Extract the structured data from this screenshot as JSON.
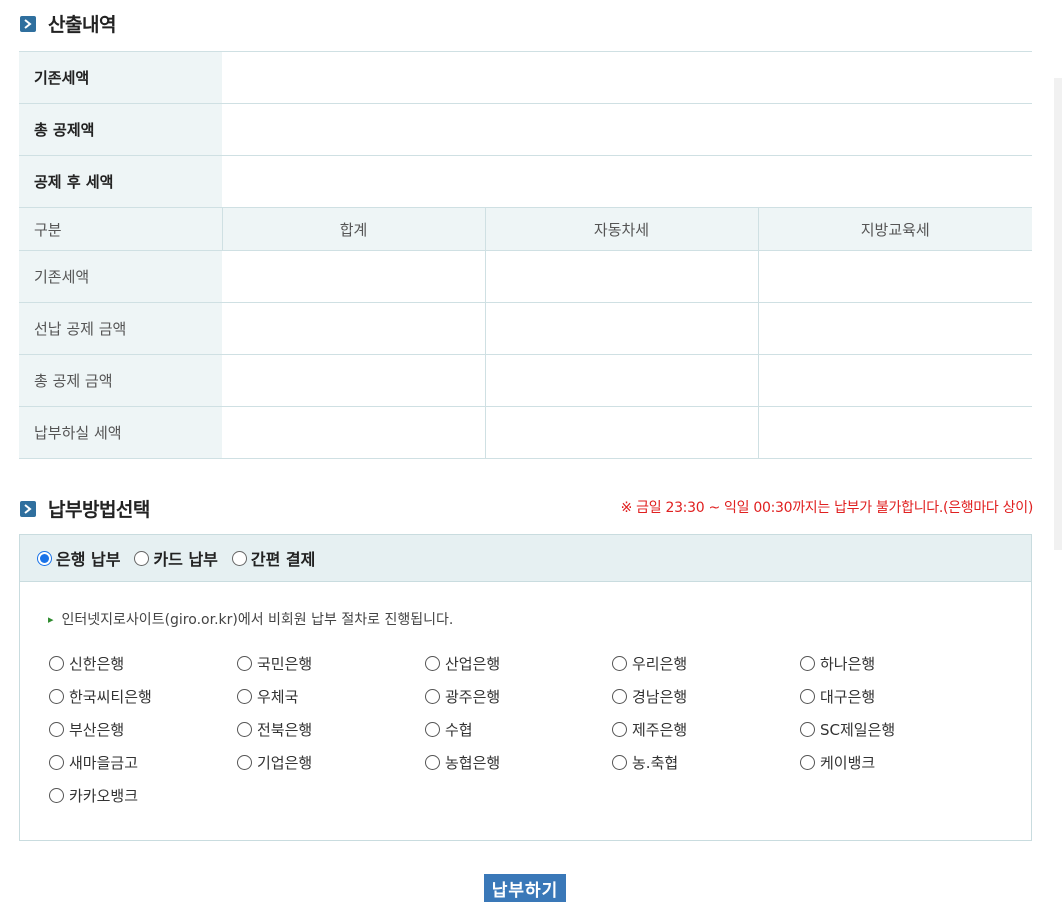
{
  "calc_section": {
    "title": "산출내역"
  },
  "calc_table": {
    "summary_rows": [
      "기존세액",
      "총 공제액",
      "공제 후 세액"
    ],
    "header": [
      "구분",
      "합계",
      "자동차세",
      "지방교육세"
    ],
    "detail_rows": [
      "기존세액",
      "선납 공제 금액",
      "총 공제 금액",
      "납부하실 세액"
    ]
  },
  "pay_section": {
    "title": "납부방법선택",
    "notice": "※ 금일 23:30 ~ 익일 00:30까지는 납부가 불가합니다.(은행마다 상이)"
  },
  "pay_methods": {
    "selected": "은행 납부",
    "options": [
      "은행 납부",
      "카드 납부",
      "간편 결제"
    ]
  },
  "bank_guide": "인터넷지로사이트(giro.or.kr)에서 비회원 납부 절차로 진행됩니다.",
  "banks": [
    "신한은행",
    "국민은행",
    "산업은행",
    "우리은행",
    "하나은행",
    "한국씨티은행",
    "우체국",
    "광주은행",
    "경남은행",
    "대구은행",
    "부산은행",
    "전북은행",
    "수협",
    "제주은행",
    "SC제일은행",
    "새마을금고",
    "기업은행",
    "농협은행",
    "농.축협",
    "케이뱅크",
    "카카오뱅크"
  ],
  "pay_button": "납부하기"
}
